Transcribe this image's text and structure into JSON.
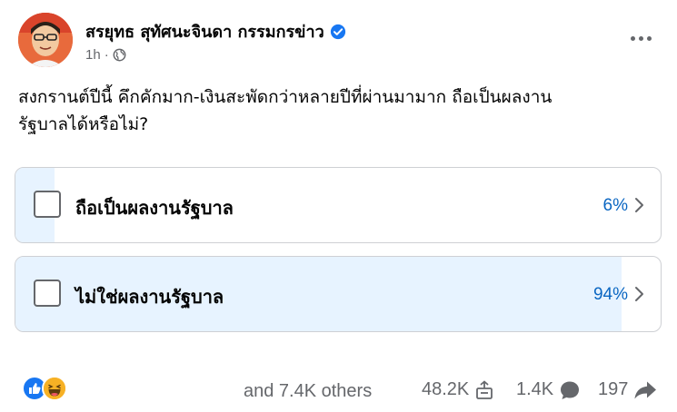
{
  "post": {
    "author": "สรยุทธ สุทัศนะจินดา กรรมกรข่าว",
    "verified": true,
    "time": "1h",
    "privacy_icon": "globe-icon",
    "text_line1": "สงกรานต์ปีนี้ คึกคักมาก-เงินสะพัดกว่าหลายปีที่ผ่านมามาก ถือเป็นผลงาน",
    "text_line2": "รัฐบาลได้หรือไม่?"
  },
  "poll": {
    "options": [
      {
        "label": "ถือเป็นผลงานรัฐบาล",
        "percent_text": "6%",
        "percent": 6
      },
      {
        "label": "ไม่ใช่ผลงานรัฐบาล",
        "percent_text": "94%",
        "percent": 94
      }
    ],
    "fill_color": "#e7f3ff",
    "percent_color": "#0a66c2"
  },
  "footer": {
    "reactions": [
      "like-icon",
      "haha-icon"
    ],
    "others_text": "and 7.4K others",
    "shares_count": "48.2K",
    "comments_count": "1.4K",
    "forwards_count": "197"
  },
  "colors": {
    "verified_blue": "#1877f2",
    "muted_text": "#65676b"
  }
}
